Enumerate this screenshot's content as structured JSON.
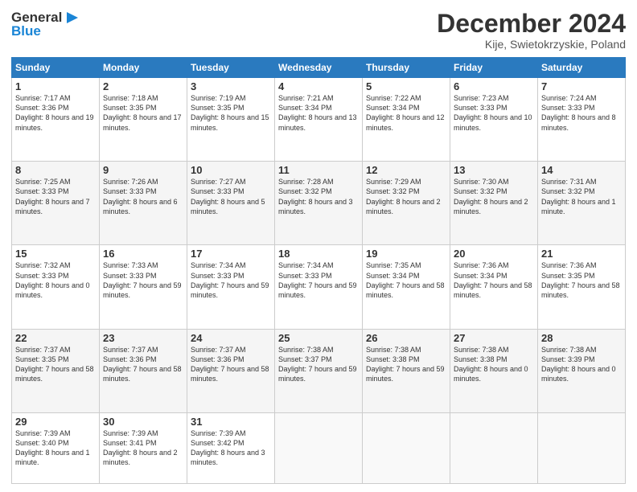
{
  "header": {
    "logo_general": "General",
    "logo_blue": "Blue",
    "month_title": "December 2024",
    "location": "Kije, Swietokrzyskie, Poland"
  },
  "days_of_week": [
    "Sunday",
    "Monday",
    "Tuesday",
    "Wednesday",
    "Thursday",
    "Friday",
    "Saturday"
  ],
  "weeks": [
    [
      {
        "day": "1",
        "sunrise": "Sunrise: 7:17 AM",
        "sunset": "Sunset: 3:36 PM",
        "daylight": "Daylight: 8 hours and 19 minutes."
      },
      {
        "day": "2",
        "sunrise": "Sunrise: 7:18 AM",
        "sunset": "Sunset: 3:35 PM",
        "daylight": "Daylight: 8 hours and 17 minutes."
      },
      {
        "day": "3",
        "sunrise": "Sunrise: 7:19 AM",
        "sunset": "Sunset: 3:35 PM",
        "daylight": "Daylight: 8 hours and 15 minutes."
      },
      {
        "day": "4",
        "sunrise": "Sunrise: 7:21 AM",
        "sunset": "Sunset: 3:34 PM",
        "daylight": "Daylight: 8 hours and 13 minutes."
      },
      {
        "day": "5",
        "sunrise": "Sunrise: 7:22 AM",
        "sunset": "Sunset: 3:34 PM",
        "daylight": "Daylight: 8 hours and 12 minutes."
      },
      {
        "day": "6",
        "sunrise": "Sunrise: 7:23 AM",
        "sunset": "Sunset: 3:33 PM",
        "daylight": "Daylight: 8 hours and 10 minutes."
      },
      {
        "day": "7",
        "sunrise": "Sunrise: 7:24 AM",
        "sunset": "Sunset: 3:33 PM",
        "daylight": "Daylight: 8 hours and 8 minutes."
      }
    ],
    [
      {
        "day": "8",
        "sunrise": "Sunrise: 7:25 AM",
        "sunset": "Sunset: 3:33 PM",
        "daylight": "Daylight: 8 hours and 7 minutes."
      },
      {
        "day": "9",
        "sunrise": "Sunrise: 7:26 AM",
        "sunset": "Sunset: 3:33 PM",
        "daylight": "Daylight: 8 hours and 6 minutes."
      },
      {
        "day": "10",
        "sunrise": "Sunrise: 7:27 AM",
        "sunset": "Sunset: 3:33 PM",
        "daylight": "Daylight: 8 hours and 5 minutes."
      },
      {
        "day": "11",
        "sunrise": "Sunrise: 7:28 AM",
        "sunset": "Sunset: 3:32 PM",
        "daylight": "Daylight: 8 hours and 3 minutes."
      },
      {
        "day": "12",
        "sunrise": "Sunrise: 7:29 AM",
        "sunset": "Sunset: 3:32 PM",
        "daylight": "Daylight: 8 hours and 2 minutes."
      },
      {
        "day": "13",
        "sunrise": "Sunrise: 7:30 AM",
        "sunset": "Sunset: 3:32 PM",
        "daylight": "Daylight: 8 hours and 2 minutes."
      },
      {
        "day": "14",
        "sunrise": "Sunrise: 7:31 AM",
        "sunset": "Sunset: 3:32 PM",
        "daylight": "Daylight: 8 hours and 1 minute."
      }
    ],
    [
      {
        "day": "15",
        "sunrise": "Sunrise: 7:32 AM",
        "sunset": "Sunset: 3:33 PM",
        "daylight": "Daylight: 8 hours and 0 minutes."
      },
      {
        "day": "16",
        "sunrise": "Sunrise: 7:33 AM",
        "sunset": "Sunset: 3:33 PM",
        "daylight": "Daylight: 7 hours and 59 minutes."
      },
      {
        "day": "17",
        "sunrise": "Sunrise: 7:34 AM",
        "sunset": "Sunset: 3:33 PM",
        "daylight": "Daylight: 7 hours and 59 minutes."
      },
      {
        "day": "18",
        "sunrise": "Sunrise: 7:34 AM",
        "sunset": "Sunset: 3:33 PM",
        "daylight": "Daylight: 7 hours and 59 minutes."
      },
      {
        "day": "19",
        "sunrise": "Sunrise: 7:35 AM",
        "sunset": "Sunset: 3:34 PM",
        "daylight": "Daylight: 7 hours and 58 minutes."
      },
      {
        "day": "20",
        "sunrise": "Sunrise: 7:36 AM",
        "sunset": "Sunset: 3:34 PM",
        "daylight": "Daylight: 7 hours and 58 minutes."
      },
      {
        "day": "21",
        "sunrise": "Sunrise: 7:36 AM",
        "sunset": "Sunset: 3:35 PM",
        "daylight": "Daylight: 7 hours and 58 minutes."
      }
    ],
    [
      {
        "day": "22",
        "sunrise": "Sunrise: 7:37 AM",
        "sunset": "Sunset: 3:35 PM",
        "daylight": "Daylight: 7 hours and 58 minutes."
      },
      {
        "day": "23",
        "sunrise": "Sunrise: 7:37 AM",
        "sunset": "Sunset: 3:36 PM",
        "daylight": "Daylight: 7 hours and 58 minutes."
      },
      {
        "day": "24",
        "sunrise": "Sunrise: 7:37 AM",
        "sunset": "Sunset: 3:36 PM",
        "daylight": "Daylight: 7 hours and 58 minutes."
      },
      {
        "day": "25",
        "sunrise": "Sunrise: 7:38 AM",
        "sunset": "Sunset: 3:37 PM",
        "daylight": "Daylight: 7 hours and 59 minutes."
      },
      {
        "day": "26",
        "sunrise": "Sunrise: 7:38 AM",
        "sunset": "Sunset: 3:38 PM",
        "daylight": "Daylight: 7 hours and 59 minutes."
      },
      {
        "day": "27",
        "sunrise": "Sunrise: 7:38 AM",
        "sunset": "Sunset: 3:38 PM",
        "daylight": "Daylight: 8 hours and 0 minutes."
      },
      {
        "day": "28",
        "sunrise": "Sunrise: 7:38 AM",
        "sunset": "Sunset: 3:39 PM",
        "daylight": "Daylight: 8 hours and 0 minutes."
      }
    ],
    [
      {
        "day": "29",
        "sunrise": "Sunrise: 7:39 AM",
        "sunset": "Sunset: 3:40 PM",
        "daylight": "Daylight: 8 hours and 1 minute."
      },
      {
        "day": "30",
        "sunrise": "Sunrise: 7:39 AM",
        "sunset": "Sunset: 3:41 PM",
        "daylight": "Daylight: 8 hours and 2 minutes."
      },
      {
        "day": "31",
        "sunrise": "Sunrise: 7:39 AM",
        "sunset": "Sunset: 3:42 PM",
        "daylight": "Daylight: 8 hours and 3 minutes."
      },
      null,
      null,
      null,
      null
    ]
  ]
}
